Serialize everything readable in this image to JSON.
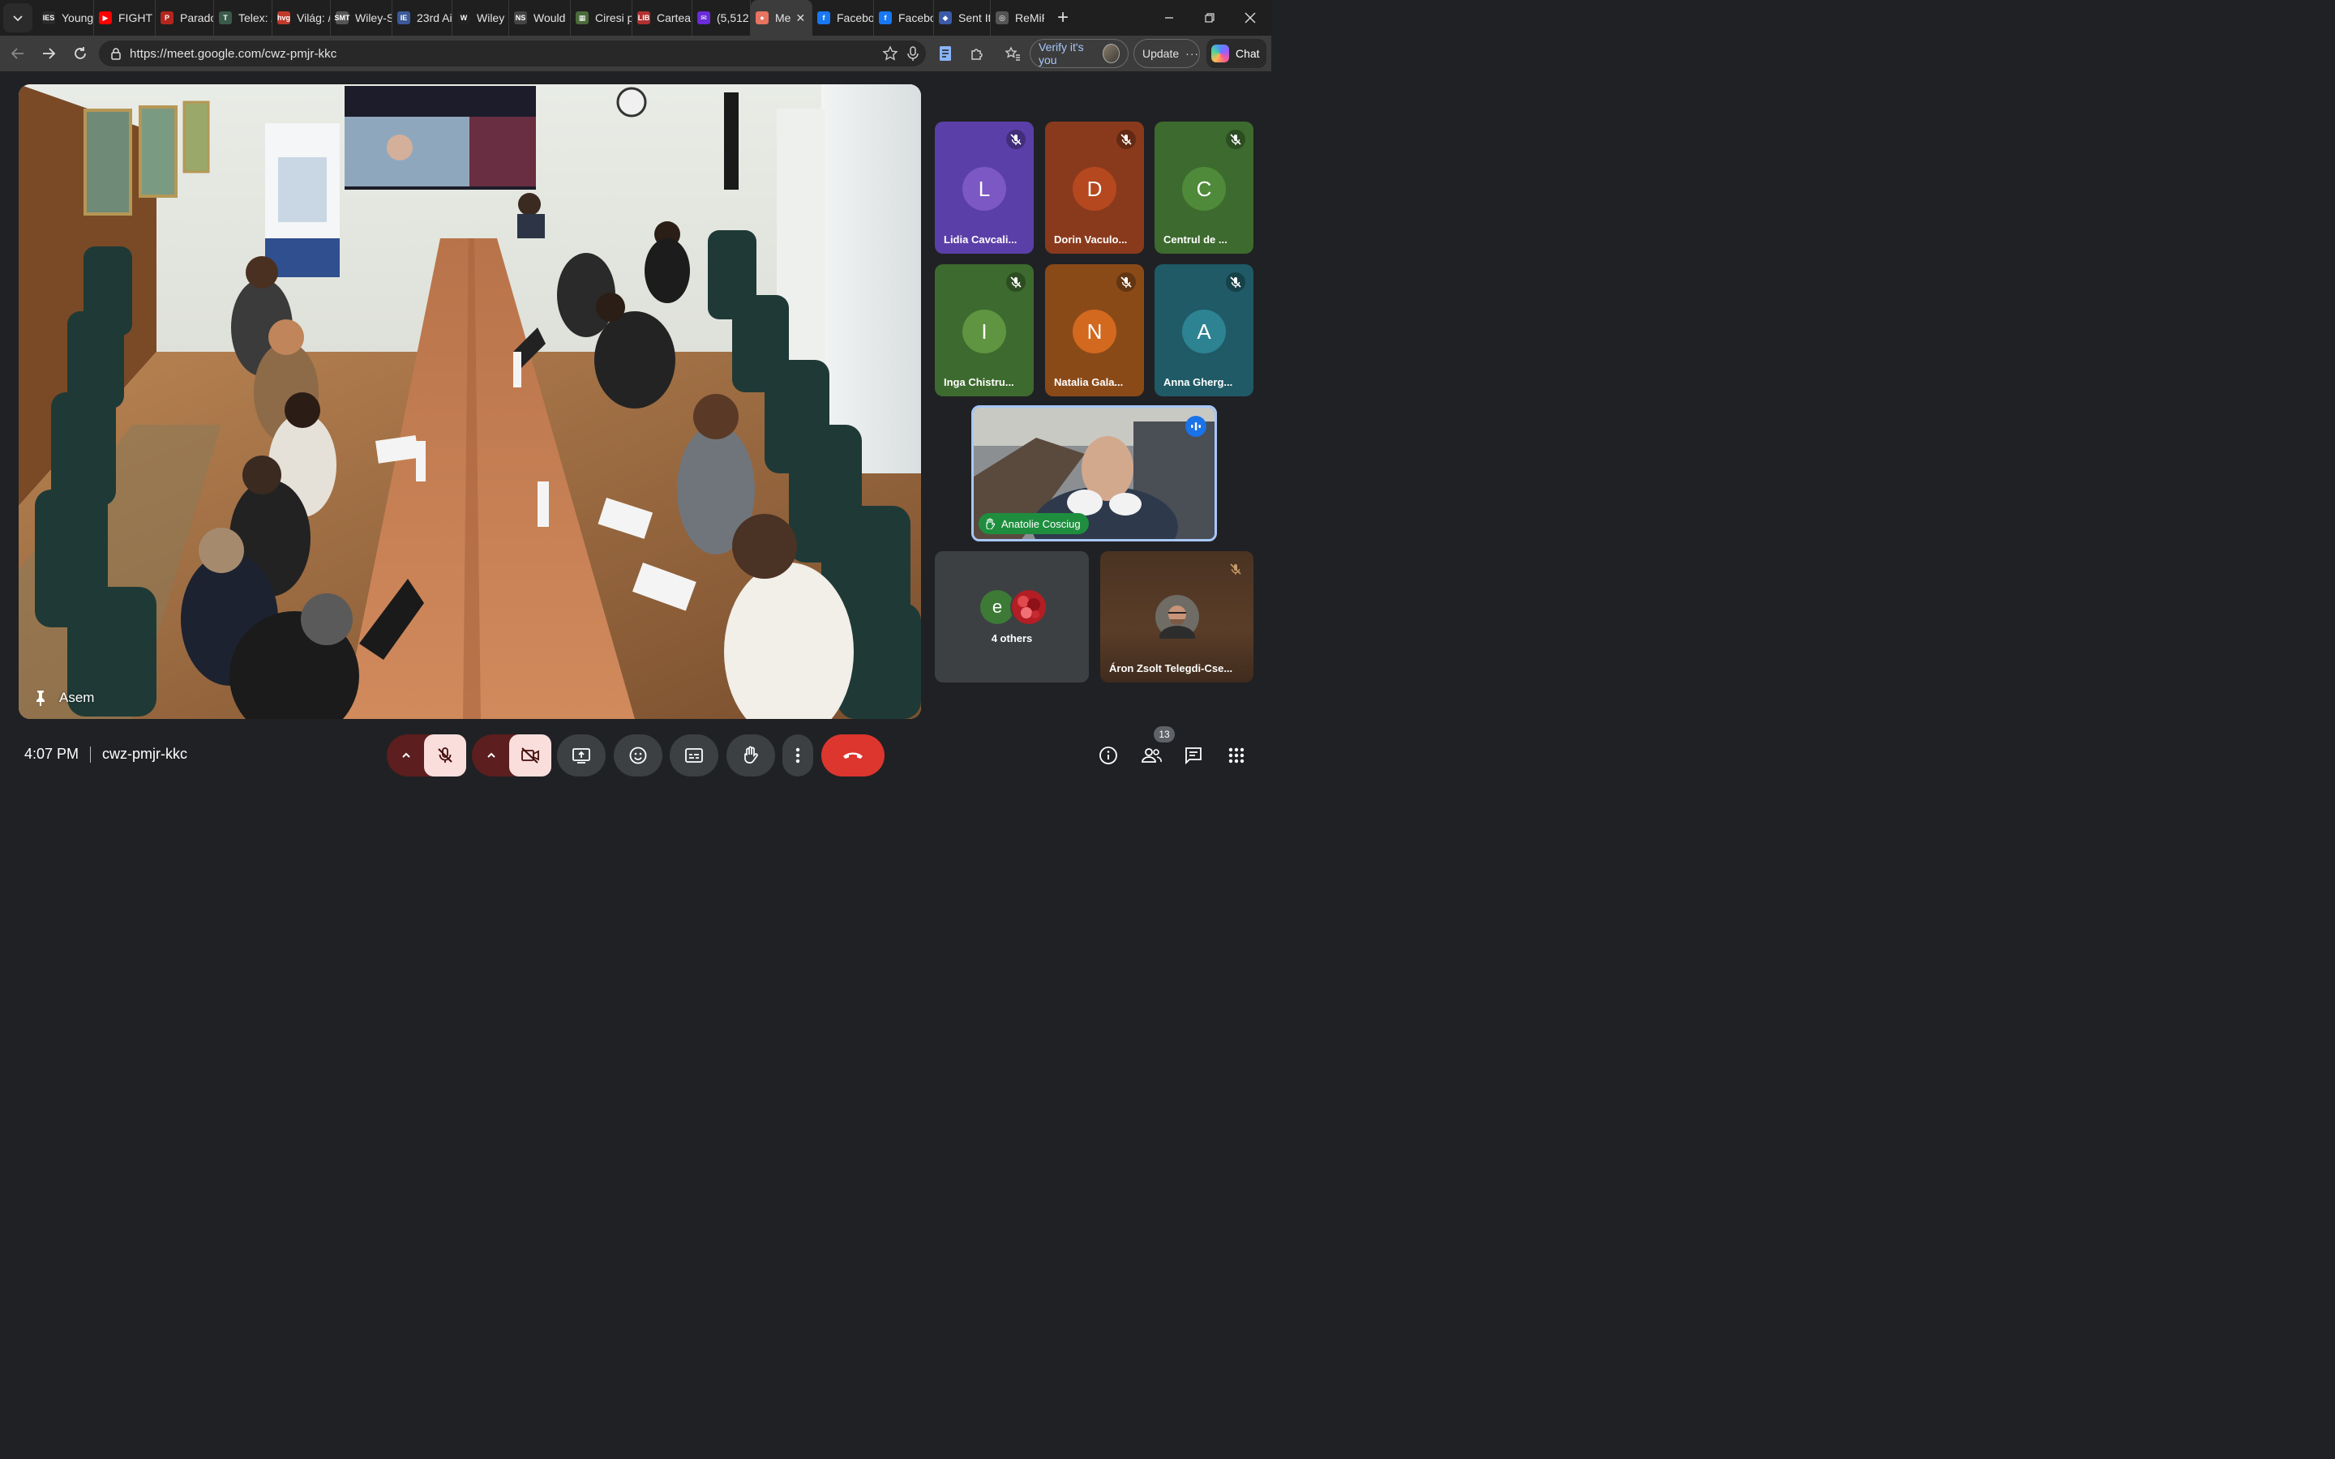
{
  "browser": {
    "tabs": [
      {
        "label": "Young",
        "favicon_text": "IES",
        "favicon_color": "#2a2a2a",
        "icon": "ies-icon"
      },
      {
        "label": "FIGHT",
        "favicon_text": "▶",
        "favicon_color": "#ff0000",
        "icon": "youtube-icon"
      },
      {
        "label": "Parado",
        "favicon_text": "P",
        "favicon_color": "#b3261e",
        "icon": "paradox-icon"
      },
      {
        "label": "Telex: /",
        "favicon_text": "T",
        "favicon_color": "#3a5a4a",
        "icon": "telex-icon"
      },
      {
        "label": "Világ: /",
        "favicon_text": "hvg",
        "favicon_color": "#c0392b",
        "icon": "hvg-icon"
      },
      {
        "label": "Wiley-S",
        "favicon_text": "SMT",
        "favicon_color": "#555555",
        "icon": "wiley-icon"
      },
      {
        "label": "23rd Ai",
        "favicon_text": "IE",
        "favicon_color": "#3b5998",
        "icon": "conference-icon"
      },
      {
        "label": "Wiley",
        "favicon_text": "W",
        "favicon_color": "#222222",
        "icon": "wiley-w-icon"
      },
      {
        "label": "Would",
        "favicon_text": "NS",
        "favicon_color": "#444444",
        "icon": "ns-icon"
      },
      {
        "label": "Ciresi p",
        "favicon_text": "▦",
        "favicon_color": "#4a6a3a",
        "icon": "image-icon"
      },
      {
        "label": "Cartea",
        "favicon_text": "LIB",
        "favicon_color": "#b03030",
        "icon": "book-icon"
      },
      {
        "label": "(5,512",
        "favicon_text": "✉",
        "favicon_color": "#6a2bd8",
        "icon": "mail-icon"
      },
      {
        "label": "Me",
        "favicon_text": "●",
        "favicon_color": "#e8735f",
        "icon": "meet-recording-icon",
        "active": true
      },
      {
        "label": "Facebo",
        "favicon_text": "f",
        "favicon_color": "#1877f2",
        "icon": "facebook-icon"
      },
      {
        "label": "Facebo",
        "favicon_text": "f",
        "favicon_color": "#1877f2",
        "icon": "facebook-icon"
      },
      {
        "label": "Sent It",
        "favicon_text": "◆",
        "favicon_color": "#3b5ba8",
        "icon": "sent-icon"
      },
      {
        "label": "ReMiR",
        "favicon_text": "◎",
        "favicon_color": "#555555",
        "icon": "globe-icon"
      }
    ],
    "url": "https://meet.google.com/cwz-pmjr-kkc",
    "verify_label": "Verify it's you",
    "update_label": "Update",
    "chat_label": "Chat"
  },
  "meet": {
    "pinned": {
      "name": "Asem"
    },
    "participants": [
      {
        "initial": "L",
        "name": "Lidia Cavcali...",
        "bg": "#5b3fa8",
        "circle": "#7b58c4",
        "muted": true
      },
      {
        "initial": "D",
        "name": "Dorin Vaculo...",
        "bg": "#8a3a1c",
        "circle": "#b5481f",
        "muted": true
      },
      {
        "initial": "C",
        "name": "Centrul de ...",
        "bg": "#3d6a2e",
        "circle": "#4f8a3a",
        "muted": true
      },
      {
        "initial": "I",
        "name": "Inga Chistru...",
        "bg": "#3d6a2e",
        "circle": "#5f9440",
        "muted": true
      },
      {
        "initial": "N",
        "name": "Natalia Gala...",
        "bg": "#8a4a18",
        "circle": "#d2691e",
        "muted": true
      },
      {
        "initial": "A",
        "name": "Anna Gherg...",
        "bg": "#1f5a66",
        "circle": "#2d8391",
        "muted": true
      }
    ],
    "speaker": {
      "name": "Anatolie Cosciug"
    },
    "others": {
      "label": "4 others",
      "initial": "e"
    },
    "aron": {
      "name": "Áron Zsolt Telegdi-Cse..."
    },
    "bottom": {
      "time": "4:07 PM",
      "meeting_code": "cwz-pmjr-kkc",
      "people_count": "13"
    }
  }
}
